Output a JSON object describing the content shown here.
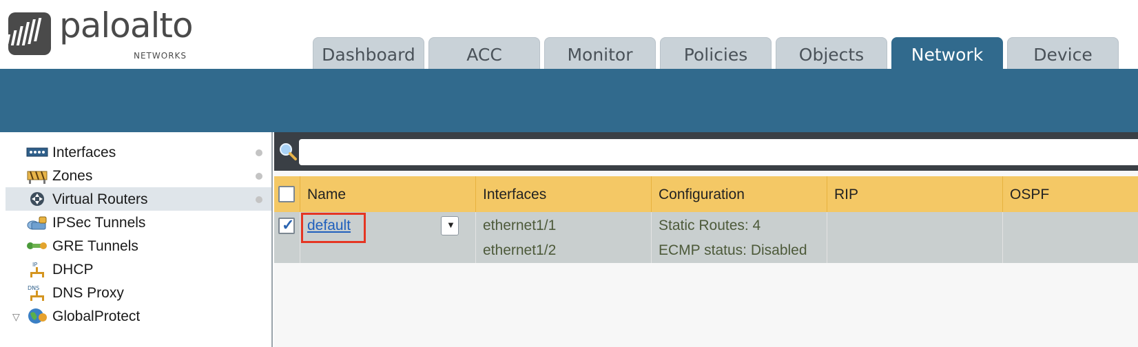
{
  "brand": {
    "name": "paloalto",
    "sub": "NETWORKS"
  },
  "tabs": [
    {
      "label": "Dashboard",
      "active": false
    },
    {
      "label": "ACC",
      "active": false
    },
    {
      "label": "Monitor",
      "active": false
    },
    {
      "label": "Policies",
      "active": false
    },
    {
      "label": "Objects",
      "active": false
    },
    {
      "label": "Network",
      "active": true
    },
    {
      "label": "Device",
      "active": false
    }
  ],
  "sidebar": {
    "items": [
      {
        "label": "Interfaces",
        "icon": "interfaces-icon",
        "selected": false
      },
      {
        "label": "Zones",
        "icon": "zones-icon",
        "selected": false
      },
      {
        "label": "Virtual Routers",
        "icon": "virtual-router-icon",
        "selected": true
      },
      {
        "label": "IPSec Tunnels",
        "icon": "ipsec-tunnel-icon",
        "selected": false
      },
      {
        "label": "GRE Tunnels",
        "icon": "gre-tunnel-icon",
        "selected": false
      },
      {
        "label": "DHCP",
        "icon": "dhcp-icon",
        "selected": false
      },
      {
        "label": "DNS Proxy",
        "icon": "dns-proxy-icon",
        "selected": false
      },
      {
        "label": "GlobalProtect",
        "icon": "globalprotect-icon",
        "selected": false
      }
    ]
  },
  "search": {
    "value": "",
    "placeholder": ""
  },
  "table": {
    "columns": [
      "Name",
      "Interfaces",
      "Configuration",
      "RIP",
      "OSPF"
    ],
    "rows": [
      {
        "checked": true,
        "name": "default",
        "interfaces": [
          "ethernet1/1",
          "ethernet1/2"
        ],
        "configuration": [
          "Static Routes: 4",
          "ECMP status: Disabled"
        ],
        "rip": "",
        "ospf": ""
      }
    ]
  },
  "colors": {
    "accent": "#316a8d",
    "header": "#f4c865",
    "row": "#c9cfcf",
    "highlight": "#e53522"
  }
}
